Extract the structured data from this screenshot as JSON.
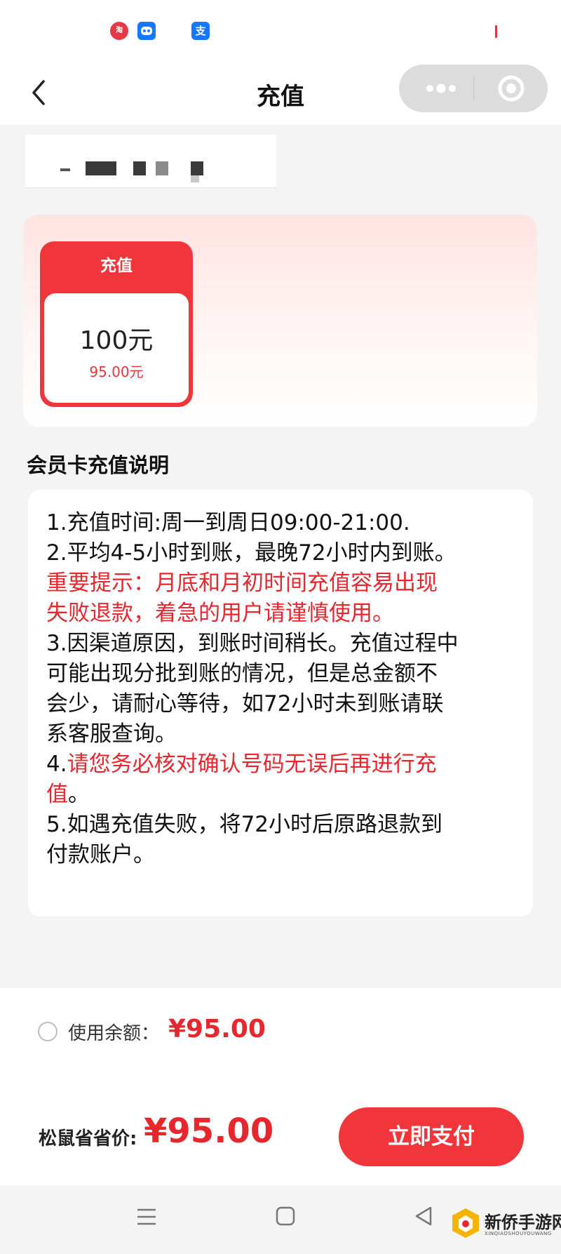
{
  "status_bar": {
    "icons": [
      "taobao-icon",
      "bot-icon",
      "alipay-icon"
    ],
    "alipay_glyph": "支"
  },
  "nav": {
    "title": "充值",
    "more_icon": "more-dots-icon",
    "close_icon": "target-close-icon"
  },
  "phone": {
    "masked_value": "' ▇ ▆ ▇ ▇"
  },
  "recharge": {
    "option": {
      "label": "充值",
      "amount": "100元",
      "price": "95.00元",
      "selected": true
    }
  },
  "notes": {
    "title": "会员卡充值说明",
    "lines": [
      {
        "text": "1.充值时间:周一到周日09:00-21:00.",
        "red": false
      },
      {
        "text": "2.平均4-5小时到账，最晚72小时内到账。",
        "red": false
      },
      {
        "text": "重要提示：月底和月初时间充值容易出现",
        "red": true
      },
      {
        "text": "失败退款，着急的用户请谨慎使用。",
        "red": true
      },
      {
        "text": "3.因渠道原因，到账时间稍长。充值过程中",
        "red": false
      },
      {
        "text": "可能出现分批到账的情况，但是总金额不",
        "red": false
      },
      {
        "text": "会少，请耐心等待，如72小时未到账请联",
        "red": false
      },
      {
        "text": "系客服查询。",
        "red": false
      },
      {
        "text_prefix": "4.",
        "text": "请您务必核对确认号码无误后再进行充",
        "red": true
      },
      {
        "text": "值",
        "red": true,
        "suffix": "。"
      },
      {
        "text": "5.如遇充值失败，将72小时后原路退款到",
        "red": false
      },
      {
        "text": "付款账户。",
        "red": false
      }
    ]
  },
  "checkout": {
    "balance_label": "使用余额：",
    "balance_value": "¥95.00",
    "total_label": "松鼠省省价:",
    "total_value": "¥95.00",
    "pay_label": "立即支付"
  },
  "watermark": {
    "text": "新侨手游网",
    "sub": "XINQIAOSHOUYOUWANG"
  },
  "colors": {
    "accent": "#f0363a",
    "price_red": "#e8262d"
  }
}
